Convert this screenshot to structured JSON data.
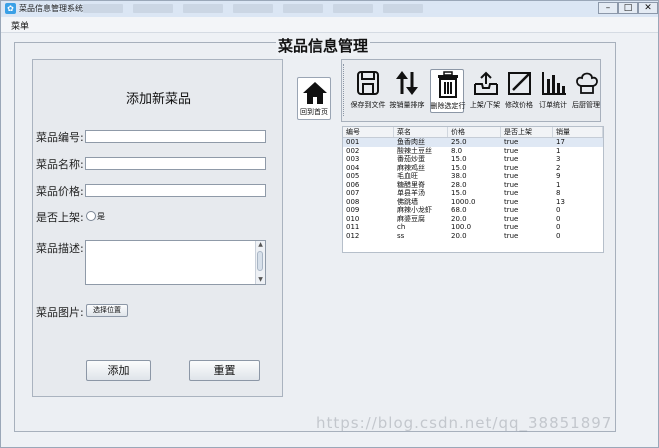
{
  "window": {
    "title": "菜品信息管理系统",
    "blurred_tabs": 7
  },
  "menu": {
    "label": "菜单"
  },
  "page": {
    "title": "菜品信息管理"
  },
  "form": {
    "title": "添加新菜品",
    "code_label": "菜品编号:",
    "name_label": "菜品名称:",
    "price_label": "菜品价格:",
    "onsale_label": "是否上架:",
    "onsale_option": "是",
    "desc_label": "菜品描述:",
    "image_label": "菜品图片:",
    "choose_location": "选择位置",
    "add": "添加",
    "reset": "重置"
  },
  "home": {
    "label": "回到首页"
  },
  "toolbar": [
    {
      "label": "保存到文件",
      "icon": "save-icon"
    },
    {
      "label": "按销量排序",
      "icon": "sort-icon"
    },
    {
      "label": "删除选定行",
      "icon": "trash-icon",
      "active": true
    },
    {
      "label": "上架/下架",
      "icon": "upload-tray-icon"
    },
    {
      "label": "修改价格",
      "icon": "edit-icon"
    },
    {
      "label": "订单统计",
      "icon": "bar-chart-icon"
    },
    {
      "label": "后厨管理",
      "icon": "chef-hat-icon"
    }
  ],
  "table": {
    "headers": [
      "编号",
      "菜名",
      "价格",
      "是否上架",
      "销量"
    ],
    "rows": [
      [
        "001",
        "鱼香肉丝",
        "25.0",
        "true",
        "17"
      ],
      [
        "002",
        "酸辣土豆丝",
        "8.0",
        "true",
        "1"
      ],
      [
        "003",
        "番茄炒蛋",
        "15.0",
        "true",
        "3"
      ],
      [
        "004",
        "麻辣鸡丝",
        "15.0",
        "true",
        "2"
      ],
      [
        "005",
        "毛血旺",
        "38.0",
        "true",
        "9"
      ],
      [
        "006",
        "糖醋里脊",
        "28.0",
        "true",
        "1"
      ],
      [
        "007",
        "单县羊汤",
        "15.0",
        "true",
        "8"
      ],
      [
        "008",
        "佛跳墙",
        "1000.0",
        "true",
        "13"
      ],
      [
        "009",
        "麻辣小龙虾",
        "68.0",
        "true",
        "0"
      ],
      [
        "010",
        "麻婆豆腐",
        "20.0",
        "true",
        "0"
      ],
      [
        "011",
        "ch",
        "100.0",
        "true",
        "0"
      ],
      [
        "012",
        "ss",
        "20.0",
        "true",
        "0"
      ]
    ]
  },
  "watermark": "https://blog.csdn.net/qq_38851897"
}
